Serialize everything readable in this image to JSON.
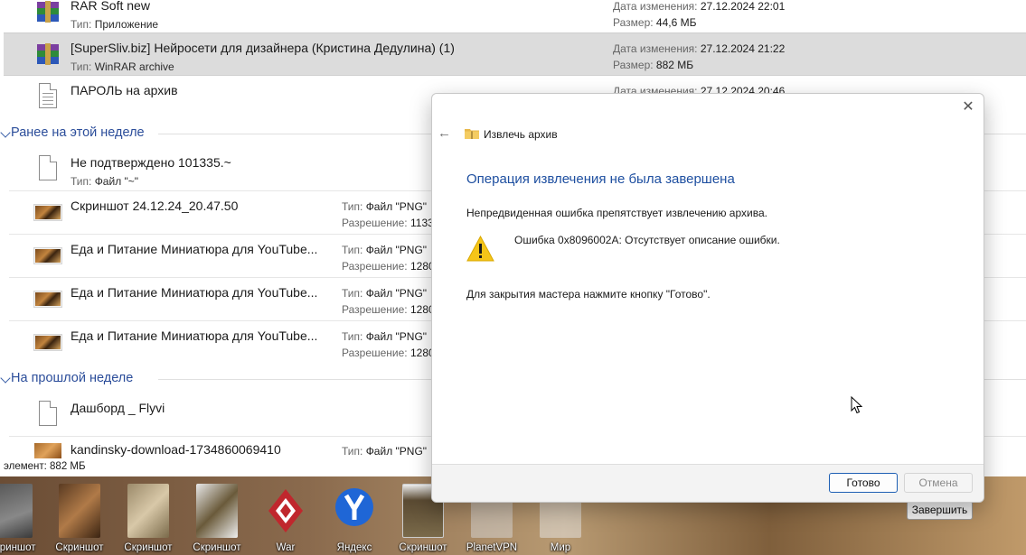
{
  "explorer": {
    "rows_top": [
      {
        "name": "RAR Soft new",
        "type_label": "Тип:",
        "type_value": "Приложение",
        "date_label": "Дата изменения:",
        "date_value": "27.12.2024 22:01",
        "size_label": "Размер:",
        "size_value": "44,6 МБ"
      },
      {
        "name": "[SuperSliv.biz] Нейросети для дизайнера (Кристина Дедулина) (1)",
        "type_label": "Тип:",
        "type_value": "WinRAR archive",
        "date_label": "Дата изменения:",
        "date_value": "27.12.2024 21:22",
        "size_label": "Размер:",
        "size_value": "882 МБ"
      },
      {
        "name": "ПАРОЛЬ на архив",
        "date_label": "Дата изменения:",
        "date_value": "27.12.2024 20:46"
      }
    ],
    "group_this_week": "Ранее на этой неделе",
    "rows_week": [
      {
        "name": "Не подтверждено 101335.~",
        "type_label": "Тип:",
        "type_value": "Файл \"~\""
      },
      {
        "name": "Скриншот 24.12.24_20.47.50",
        "type_label": "Тип:",
        "type_value": "Файл \"PNG\"",
        "res_label": "Разрешение:",
        "res_value": "1133"
      },
      {
        "name": "Еда и Питание Миниатюра для YouTube...",
        "type_label": "Тип:",
        "type_value": "Файл \"PNG\"",
        "res_label": "Разрешение:",
        "res_value": "1280"
      },
      {
        "name": "Еда и Питание Миниатюра для YouTube...",
        "type_label": "Тип:",
        "type_value": "Файл \"PNG\"",
        "res_label": "Разрешение:",
        "res_value": "1280"
      },
      {
        "name": "Еда и Питание Миниатюра для YouTube...",
        "type_label": "Тип:",
        "type_value": "Файл \"PNG\"",
        "res_label": "Разрешение:",
        "res_value": "1280"
      }
    ],
    "group_last_week": "На прошлой неделе",
    "rows_last": [
      {
        "name": "Дашборд _ Flyvi"
      },
      {
        "name": "kandinsky-download-1734860069410",
        "type_label": "Тип:",
        "type_value": "Файл \"PNG\""
      }
    ],
    "status_text": "элемент: 882 МБ"
  },
  "dialog": {
    "title": "Извлечь архив",
    "heading": "Операция извлечения не была завершена",
    "description": "Непредвиденная ошибка препятствует извлечению архива.",
    "error_text": "Ошибка 0x8096002A: Отсутствует описание ошибки.",
    "close_hint": "Для закрытия мастера нажмите кнопку \"Готово\".",
    "ok_label": "Готово",
    "cancel_label": "Отмена"
  },
  "desktop": {
    "icons": [
      "Скриншот",
      "Скриншот",
      "Скриншот",
      "Скриншот",
      "War",
      "Яндекс",
      "Скриншот",
      "PlanetVPN",
      "Мир"
    ],
    "finish_label": "Завершить"
  },
  "colors": {
    "accent": "#1e4fa0",
    "group": "#2b4d9a",
    "selected_row": "#dcdcdc"
  }
}
